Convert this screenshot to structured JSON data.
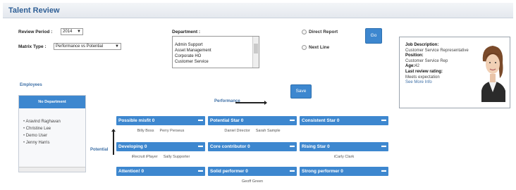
{
  "app": {
    "title": "Talent Review"
  },
  "filters": {
    "review_period_label": "Review Period :",
    "review_period_value": "2014",
    "matrix_type_label": "Matrix Type :",
    "matrix_type_value": "Performance vs Potential",
    "department_label": "Department :",
    "department_options": [
      "Admin Support",
      "Asset Management",
      "Corporate HO",
      "Customer Service"
    ],
    "direct_report_label": "Direct Report",
    "next_line_label": "Next Line",
    "go_label": "Go",
    "save_label": "Save"
  },
  "employees": {
    "label": "Employees",
    "panel_header": "No Department",
    "items": [
      "Aravind Raghavan",
      "Christine Lee",
      "Demo User",
      "Jenny Harris"
    ]
  },
  "axes": {
    "performance": "Performance",
    "potential": "Potential"
  },
  "matrix": [
    {
      "title": "Possible misfit",
      "count": "0",
      "people": [
        "Billy Boss",
        "Perry Perseus"
      ]
    },
    {
      "title": "Potential Star",
      "count": "0",
      "people": [
        "Daniel Director",
        "Sarah Sample"
      ]
    },
    {
      "title": "Consistent Star",
      "count": "0",
      "people": []
    },
    {
      "title": "Developing",
      "count": "0",
      "people": [
        "iRecruit iPlayer",
        "Sally Supporter"
      ]
    },
    {
      "title": "Core contributor",
      "count": "0",
      "people": []
    },
    {
      "title": "Rising Star",
      "count": "0",
      "people": [
        "iCarly Clark"
      ]
    },
    {
      "title": "Attention!",
      "count": "0",
      "people": []
    },
    {
      "title": "Solid performer",
      "count": "0",
      "people": [
        "Geoff Green"
      ]
    },
    {
      "title": "Strong performer",
      "count": "0",
      "people": []
    }
  ],
  "profile": {
    "job_description_label": "Job Description:",
    "job_description_value": "Customer Service Representative",
    "position_label": "Position:",
    "position_value": "Customer Service Rep",
    "age_label": "Age:",
    "age_value": "42",
    "last_review_label": "Last review rating:",
    "last_review_value": "Meets expectation",
    "see_more": "See More Info"
  },
  "colors": {
    "accent": "#3d87cf",
    "title": "#2f5f96",
    "link": "#3d6fa6"
  }
}
